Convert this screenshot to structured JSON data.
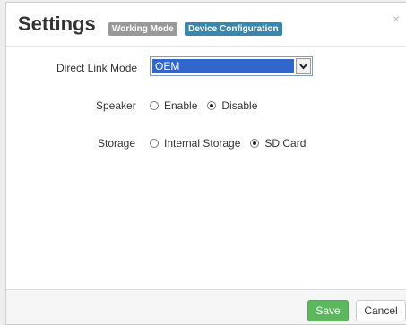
{
  "dialog": {
    "title": "Settings",
    "badges": {
      "working_mode": "Working Mode",
      "device_configuration": "Device Configuration"
    },
    "close_label": "×"
  },
  "form": {
    "direct_link_mode": {
      "label": "Direct Link Mode",
      "selected": "OEM"
    },
    "speaker": {
      "label": "Speaker",
      "options": [
        "Enable",
        "Disable"
      ],
      "selected": "Disable"
    },
    "storage": {
      "label": "Storage",
      "options": [
        "Internal Storage",
        "SD Card"
      ],
      "selected": "SD Card"
    }
  },
  "footer": {
    "save_label": "Save",
    "cancel_label": "Cancel"
  },
  "colors": {
    "save_button": "#5cb85c",
    "device_badge": "#3a87ad",
    "working_badge": "#999999",
    "select_highlight": "#3366cc"
  }
}
